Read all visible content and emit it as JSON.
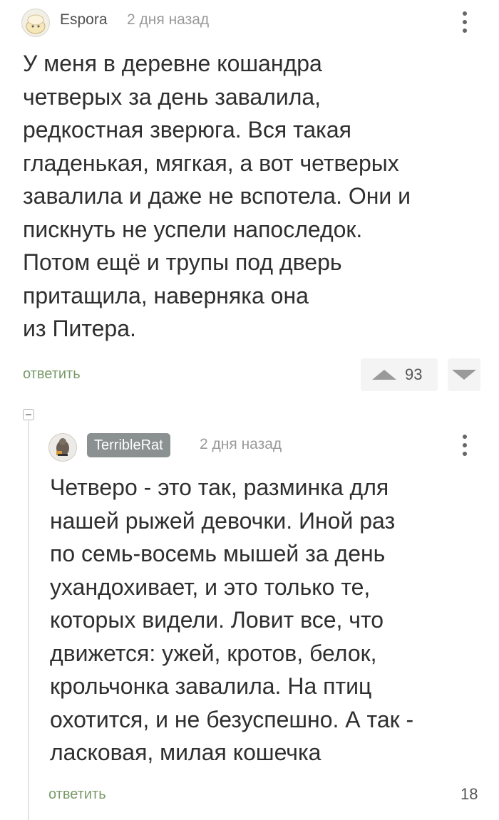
{
  "comments": [
    {
      "author": "Espora",
      "time": "2 дня назад",
      "lines": [
        "У меня в деревне кошандра",
        "четверых за день завалила,",
        "редкостная зверюга. Вся такая",
        "гладенькая, мягкая, а вот четверых",
        "завалила и даже не вспотела. Они и",
        "пискнуть не успели напоследок.",
        "Потом ещё и трупы под дверь",
        "притащила, наверняка она",
        "из Питера."
      ],
      "reply_label": "ответить",
      "rating": "93"
    },
    {
      "author": "TerribleRat",
      "time": "2 дня назад",
      "lines": [
        "Четверо - это так, разминка для",
        "нашей рыжей девочки. Иной раз",
        "по семь-восемь мышей за день",
        "ухандохивает, и это только те,",
        "которых видели. Ловит все, что",
        "движется: ужей, кротов, белок,",
        "крольчонка завалила. На птиц",
        "охотится, и не безуспешно. А так -",
        "ласковая, милая кошечка"
      ],
      "reply_label": "ответить",
      "rating": "18"
    }
  ],
  "icons": {
    "menu": "more-vertical-icon",
    "upvote": "triangle-up-icon",
    "downvote": "triangle-down-icon",
    "collapse": "collapse-thread-icon"
  },
  "colors": {
    "reply": "#7a9a6a",
    "author_badge": "#8b9190",
    "vote_bg": "#f4f4f4"
  }
}
